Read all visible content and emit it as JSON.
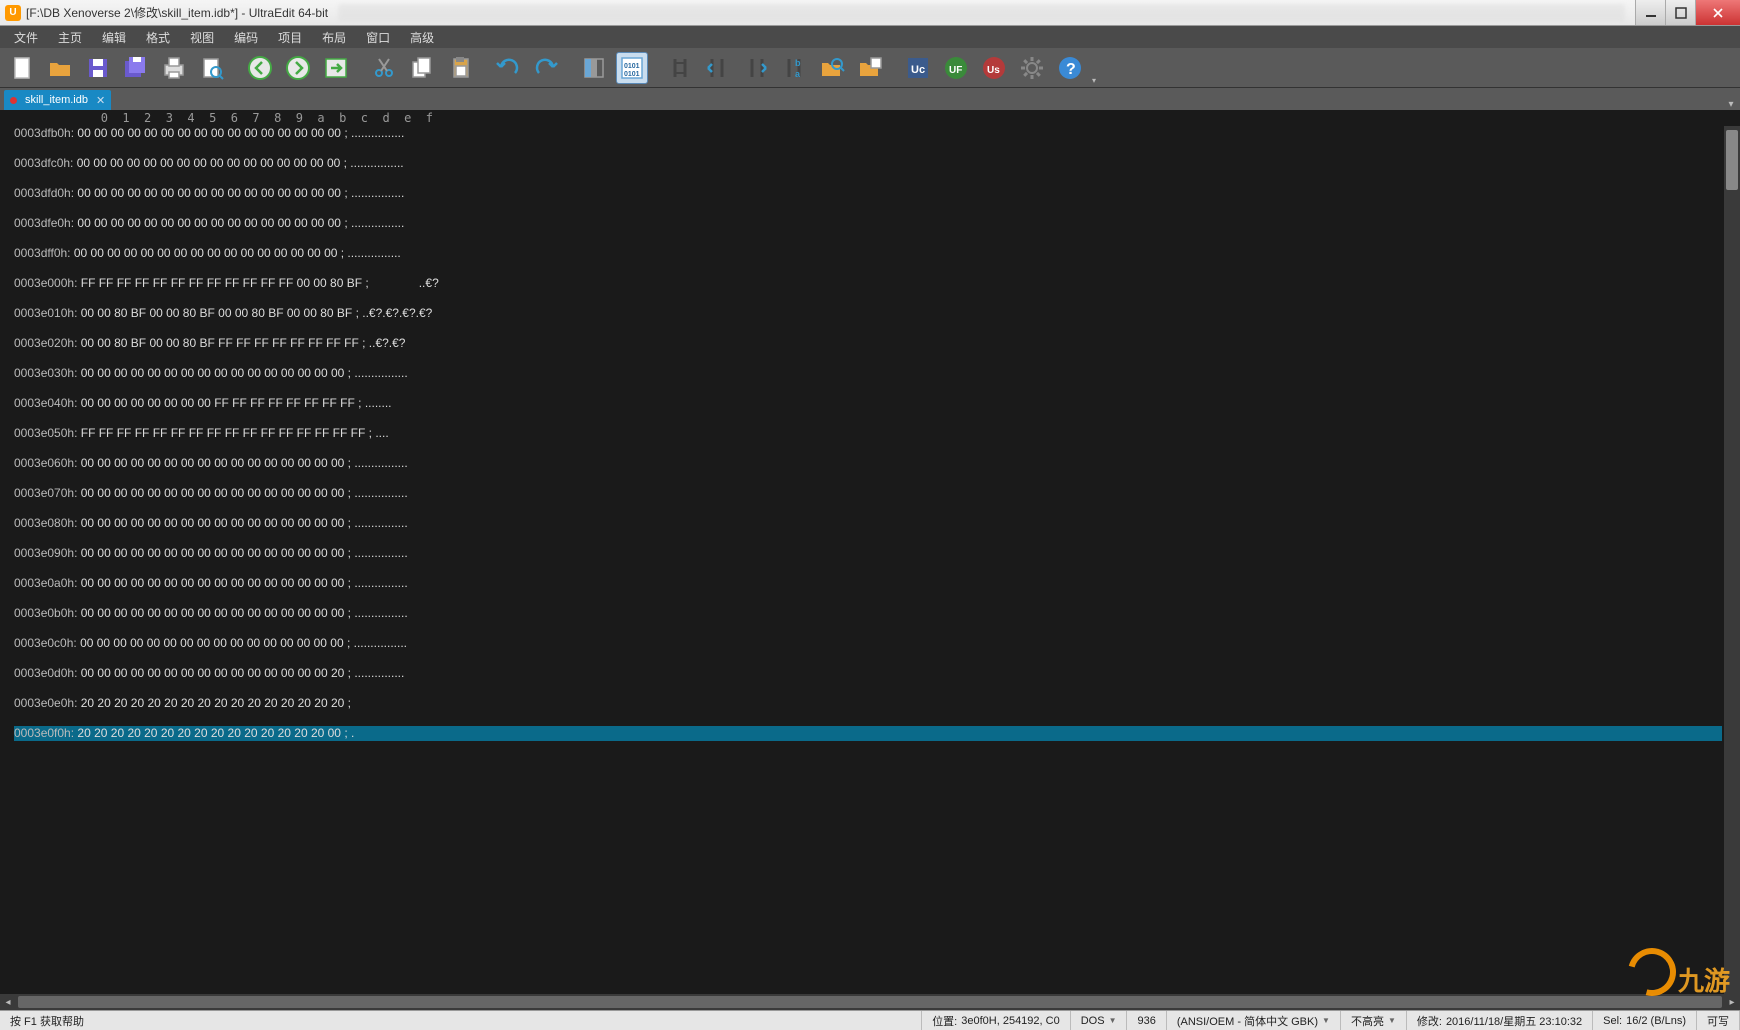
{
  "window": {
    "title": "[F:\\DB Xenoverse 2\\修改\\skill_item.idb*] - UltraEdit 64-bit"
  },
  "menu": {
    "items": [
      "文件",
      "主页",
      "编辑",
      "格式",
      "视图",
      "编码",
      "项目",
      "布局",
      "窗口",
      "高级"
    ]
  },
  "toolbar": {
    "icons": [
      "new-file",
      "open-folder",
      "save",
      "save-all",
      "print",
      "print-preview",
      "",
      "nav-back",
      "nav-forward",
      "nav-go",
      "",
      "cut",
      "copy",
      "paste",
      "",
      "undo",
      "redo",
      "",
      "column-mode",
      "hex-mode",
      "",
      "find",
      "find-prev",
      "find-next",
      "find-replace",
      "find-in-files",
      "find-in-files-results",
      "",
      "tools-uc",
      "tools-uf",
      "tools-us",
      "settings",
      "help"
    ],
    "active": "hex-mode"
  },
  "tab": {
    "label": "skill_item.idb",
    "modified": true
  },
  "hex": {
    "ruler": "            0  1  2  3  4  5  6  7  8  9  a  b  c  d  e  f",
    "lines": [
      {
        "addr": "0003dfb0h:",
        "bytes": "00 00 00 00 00 00 00 00 00 00 00 00 00 00 00 00",
        "ascii": "................"
      },
      {
        "addr": "0003dfc0h:",
        "bytes": "00 00 00 00 00 00 00 00 00 00 00 00 00 00 00 00",
        "ascii": "................"
      },
      {
        "addr": "0003dfd0h:",
        "bytes": "00 00 00 00 00 00 00 00 00 00 00 00 00 00 00 00",
        "ascii": "................"
      },
      {
        "addr": "0003dfe0h:",
        "bytes": "00 00 00 00 00 00 00 00 00 00 00 00 00 00 00 00",
        "ascii": "................"
      },
      {
        "addr": "0003dff0h:",
        "bytes": "00 00 00 00 00 00 00 00 00 00 00 00 00 00 00 00",
        "ascii": "................"
      },
      {
        "addr": "0003e000h:",
        "bytes": "FF FF FF FF FF FF FF FF FF FF FF FF 00 00 80 BF",
        "ascii": "              ..€?"
      },
      {
        "addr": "0003e010h:",
        "bytes": "00 00 80 BF 00 00 80 BF 00 00 80 BF 00 00 80 BF",
        "ascii": "..€?.€?.€?.€?"
      },
      {
        "addr": "0003e020h:",
        "bytes": "00 00 80 BF 00 00 80 BF FF FF FF FF FF FF FF FF",
        "ascii": "..€?.€?"
      },
      {
        "addr": "0003e030h:",
        "bytes": "00 00 00 00 00 00 00 00 00 00 00 00 00 00 00 00",
        "ascii": "................"
      },
      {
        "addr": "0003e040h:",
        "bytes": "00 00 00 00 00 00 00 00 FF FF FF FF FF FF FF FF",
        "ascii": "........"
      },
      {
        "addr": "0003e050h:",
        "bytes": "FF FF FF FF FF FF FF FF FF FF FF FF FF FF FF FF",
        "ascii": "...."
      },
      {
        "addr": "0003e060h:",
        "bytes": "00 00 00 00 00 00 00 00 00 00 00 00 00 00 00 00",
        "ascii": "................"
      },
      {
        "addr": "0003e070h:",
        "bytes": "00 00 00 00 00 00 00 00 00 00 00 00 00 00 00 00",
        "ascii": "................"
      },
      {
        "addr": "0003e080h:",
        "bytes": "00 00 00 00 00 00 00 00 00 00 00 00 00 00 00 00",
        "ascii": "................"
      },
      {
        "addr": "0003e090h:",
        "bytes": "00 00 00 00 00 00 00 00 00 00 00 00 00 00 00 00",
        "ascii": "................"
      },
      {
        "addr": "0003e0a0h:",
        "bytes": "00 00 00 00 00 00 00 00 00 00 00 00 00 00 00 00",
        "ascii": "................"
      },
      {
        "addr": "0003e0b0h:",
        "bytes": "00 00 00 00 00 00 00 00 00 00 00 00 00 00 00 00",
        "ascii": "................"
      },
      {
        "addr": "0003e0c0h:",
        "bytes": "00 00 00 00 00 00 00 00 00 00 00 00 00 00 00 00",
        "ascii": "................"
      },
      {
        "addr": "0003e0d0h:",
        "bytes": "00 00 00 00 00 00 00 00 00 00 00 00 00 00 00 20",
        "ascii": "............... "
      },
      {
        "addr": "0003e0e0h:",
        "bytes": "20 20 20 20 20 20 20 20 20 20 20 20 20 20 20 20",
        "ascii": ""
      },
      {
        "addr": "0003e0f0h:",
        "bytes": "20 20 20 20 20 20 20 20 20 20 20 20 20 20 20 00",
        "ascii": ".",
        "selected": true
      }
    ]
  },
  "status": {
    "hint": "按 F1 获取帮助",
    "pos_label": "位置:",
    "pos_value": "3e0f0H, 254192, C0",
    "lineending": "DOS",
    "codepage": "936",
    "encoding": "(ANSI/OEM - 简体中文 GBK)",
    "highlight": "不高亮",
    "mod_label": "修改:",
    "mod_value": "2016/11/18/星期五 23:10:32",
    "sel_label": "Sel:",
    "sel_value": "16/2 (B/Lns)",
    "rw": "可写"
  },
  "watermark": {
    "text": "九游"
  },
  "colors": {
    "accent": "#1989c4",
    "selection": "#0a6a8a"
  }
}
